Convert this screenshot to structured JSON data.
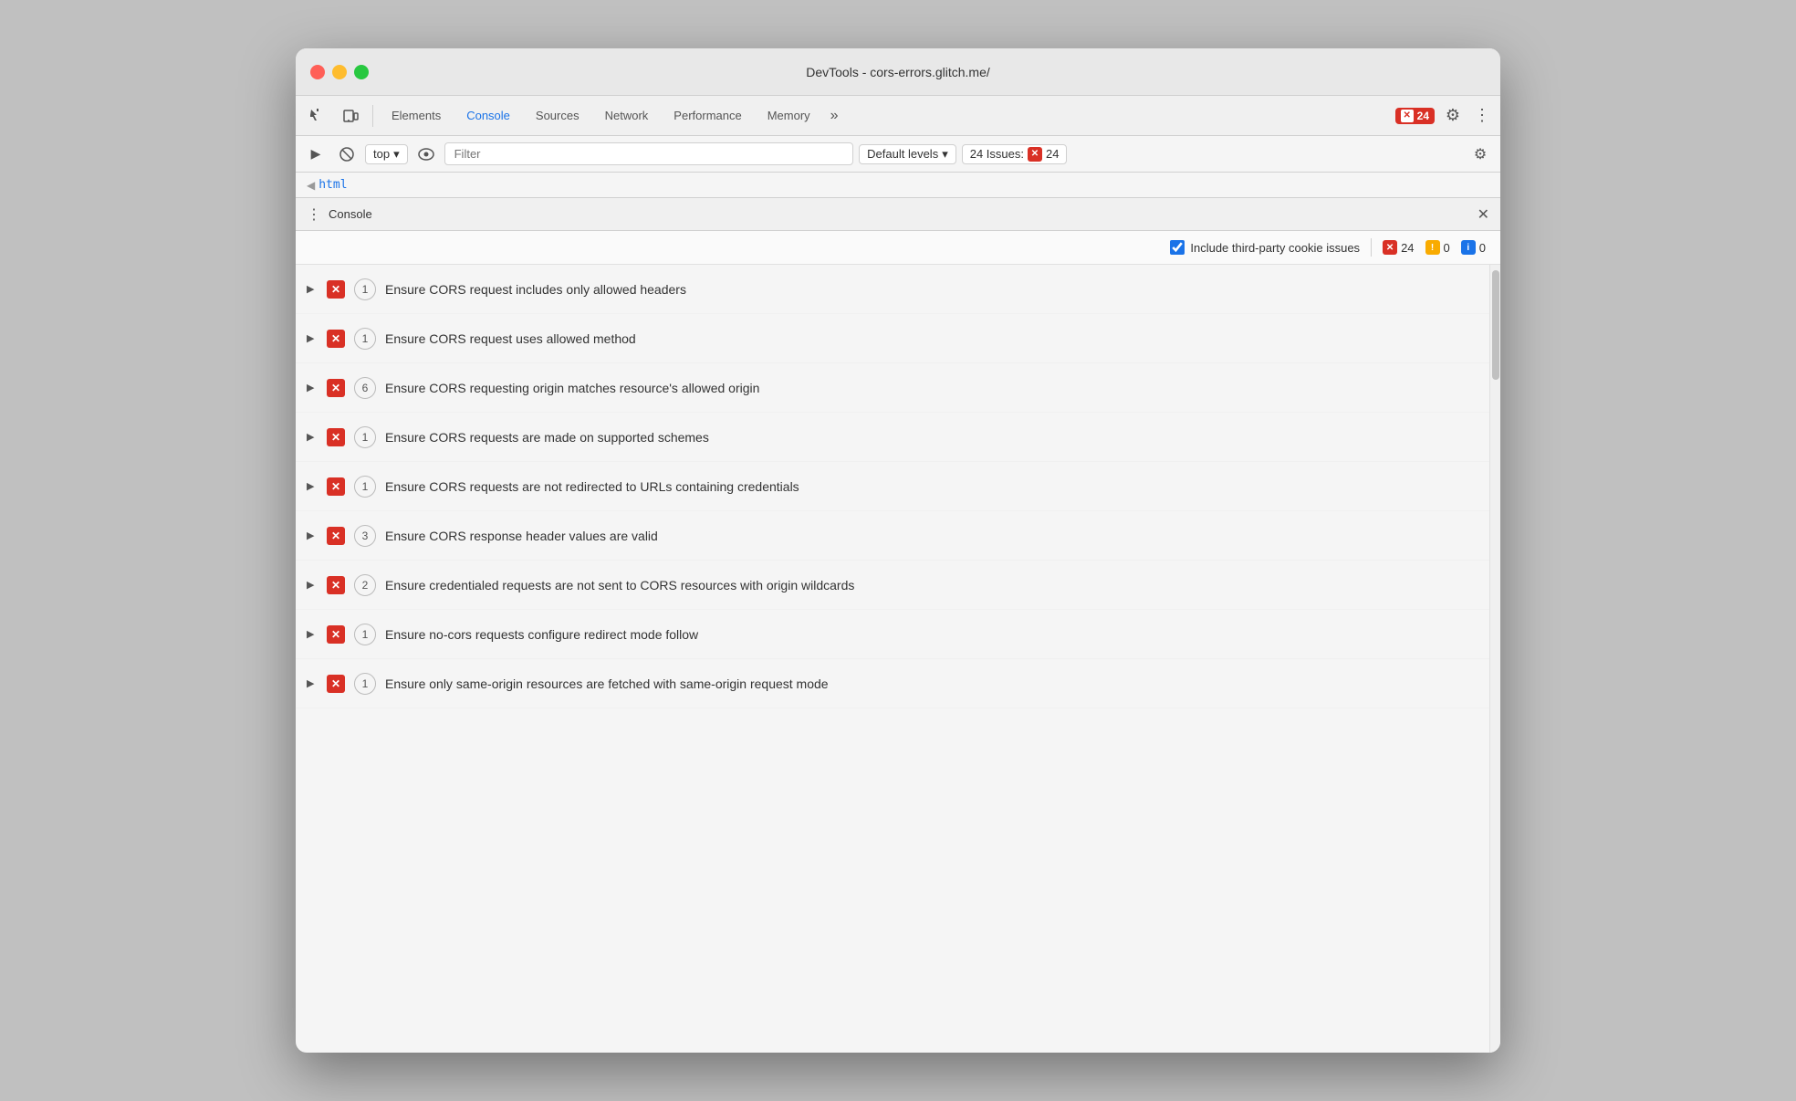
{
  "window": {
    "title": "DevTools - cors-errors.glitch.me/"
  },
  "toolbar": {
    "tabs": [
      {
        "label": "Elements",
        "active": false
      },
      {
        "label": "Console",
        "active": true
      },
      {
        "label": "Sources",
        "active": false
      },
      {
        "label": "Network",
        "active": false
      },
      {
        "label": "Performance",
        "active": false
      },
      {
        "label": "Memory",
        "active": false
      }
    ],
    "more_tabs": "»",
    "error_count": "24",
    "gear_icon": "⚙",
    "more_icon": "⋮"
  },
  "console_toolbar": {
    "run_icon": "▶",
    "block_icon": "🚫",
    "top_label": "top",
    "eye_icon": "👁",
    "filter_placeholder": "Filter",
    "levels_label": "Default levels",
    "issues_label": "24 Issues:",
    "issues_count": "24",
    "gear_icon": "⚙"
  },
  "breadcrumb": {
    "arrow": "◀",
    "item": "html"
  },
  "console_panel": {
    "menu_icon": "⋮",
    "title": "Console",
    "close_icon": "✕"
  },
  "issues_filter": {
    "checkbox_label": "Include third-party cookie issues",
    "error_count": "24",
    "warning_count": "0",
    "info_count": "0"
  },
  "issues": [
    {
      "count": 1,
      "text": "Ensure CORS request includes only allowed headers"
    },
    {
      "count": 1,
      "text": "Ensure CORS request uses allowed method"
    },
    {
      "count": 6,
      "text": "Ensure CORS requesting origin matches resource's allowed origin"
    },
    {
      "count": 1,
      "text": "Ensure CORS requests are made on supported schemes"
    },
    {
      "count": 1,
      "text": "Ensure CORS requests are not redirected to URLs containing credentials"
    },
    {
      "count": 3,
      "text": "Ensure CORS response header values are valid"
    },
    {
      "count": 2,
      "text": "Ensure credentialed requests are not sent to CORS resources with origin wildcards"
    },
    {
      "count": 1,
      "text": "Ensure no-cors requests configure redirect mode follow"
    },
    {
      "count": 1,
      "text": "Ensure only same-origin resources are fetched with same-origin request mode"
    }
  ]
}
